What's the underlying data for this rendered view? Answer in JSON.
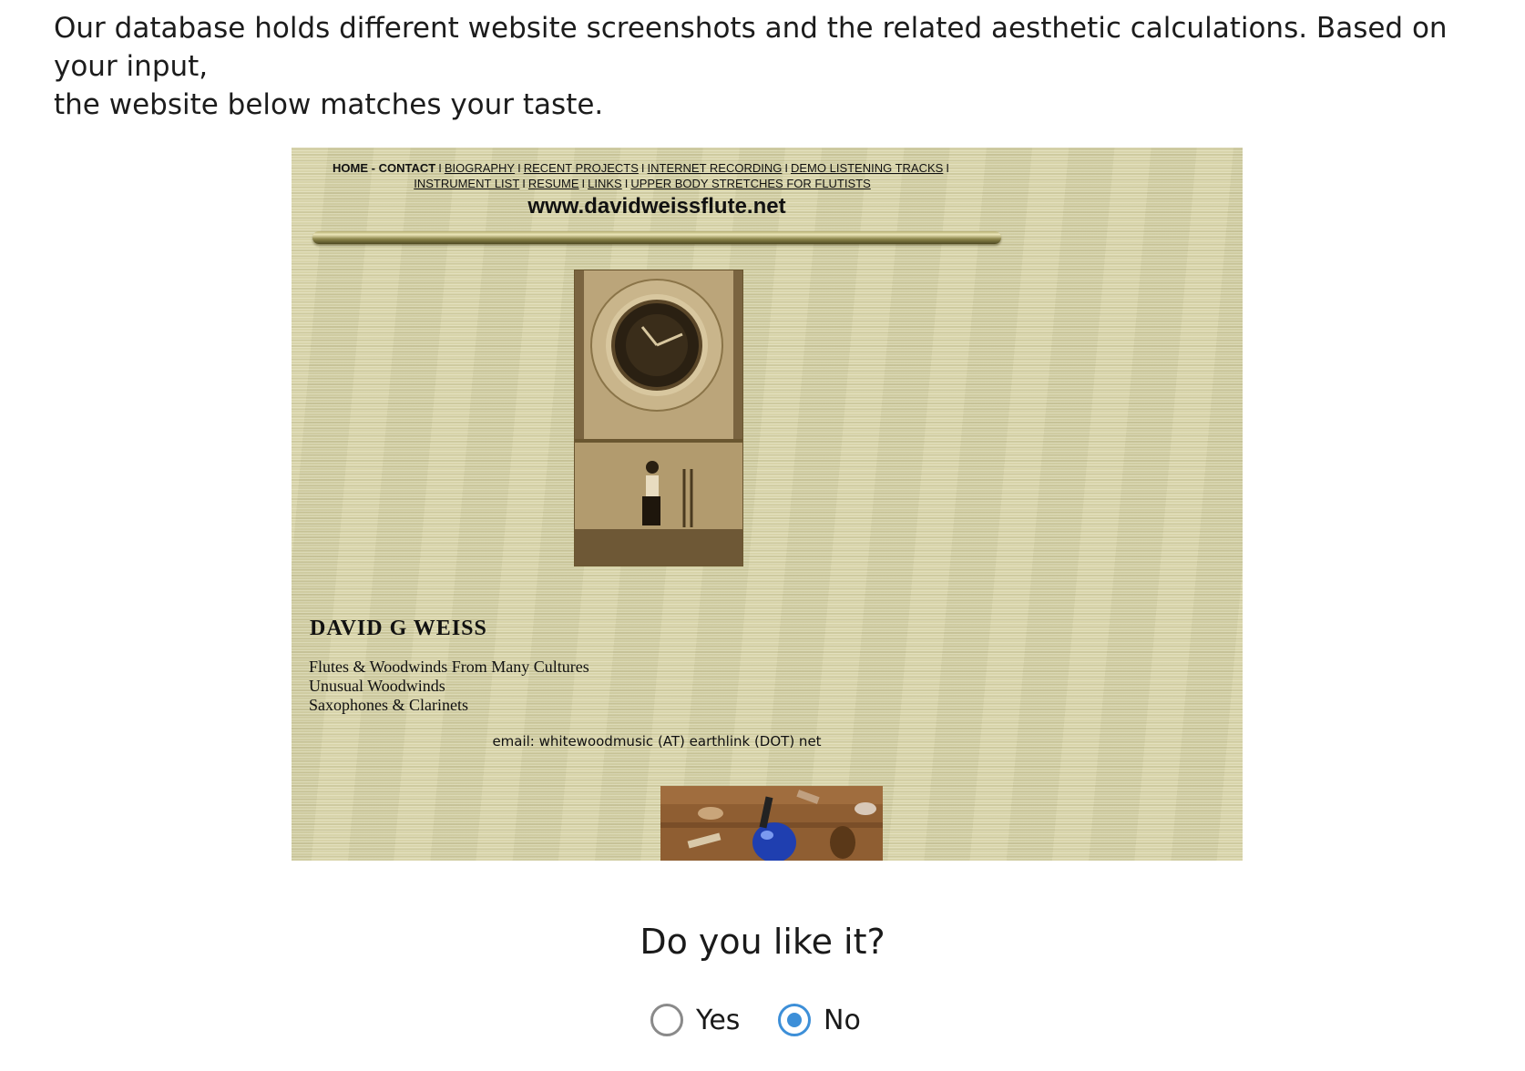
{
  "intro": {
    "line1": "Our database holds different website screenshots and the related aesthetic calculations. Based on your input,",
    "line2": "the website below matches your taste."
  },
  "screenshot": {
    "nav": {
      "row1": [
        {
          "label": "HOME - CONTACT",
          "current": true
        },
        {
          "label": "BIOGRAPHY"
        },
        {
          "label": "RECENT PROJECTS"
        },
        {
          "label": "INTERNET RECORDING"
        },
        {
          "label": "DEMO LISTENING TRACKS"
        }
      ],
      "row2": [
        {
          "label": "INSTRUMENT LIST"
        },
        {
          "label": "RESUME"
        },
        {
          "label": "LINKS"
        },
        {
          "label": "UPPER BODY STRETCHES FOR FLUTISTS"
        }
      ],
      "separator": "I"
    },
    "site_url": "www.davidweissflute.net",
    "name": "DAVID  G  WEISS",
    "lines": [
      "Flutes & Woodwinds From Many Cultures",
      "Unusual Woodwinds",
      "Saxophones & Clarinets"
    ],
    "email": "email: whitewoodmusic (AT) earthlink (DOT) net"
  },
  "question": "Do you like it?",
  "choices": [
    {
      "label": "Yes",
      "checked": false
    },
    {
      "label": "No",
      "checked": true
    }
  ],
  "colors": {
    "accent": "#3d8fd8",
    "screenshot_background": "#d6d2a6"
  }
}
